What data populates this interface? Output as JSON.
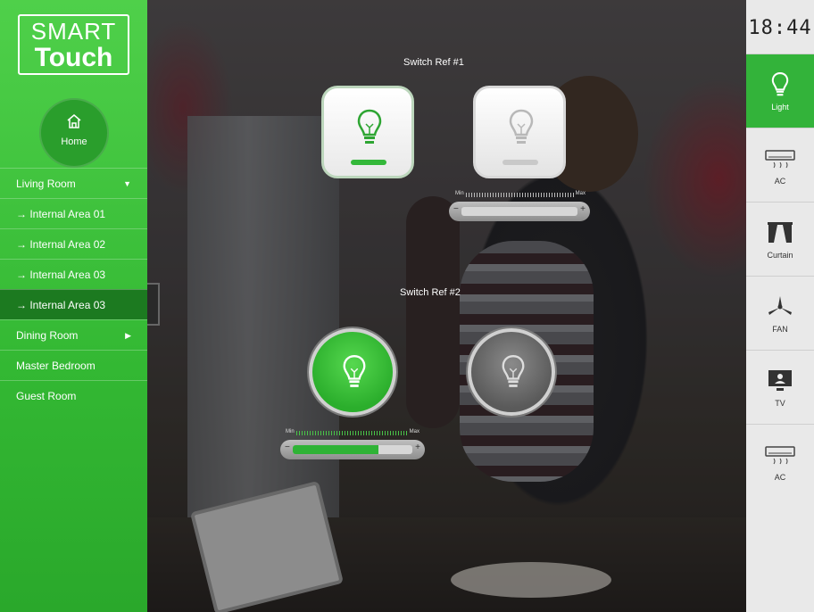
{
  "brand": {
    "line1": "SMART",
    "line2": "Touch"
  },
  "home": {
    "label": "Home"
  },
  "nav": [
    {
      "label": "Living Room",
      "arrow": "▼"
    },
    {
      "label": "→  Internal Area 01"
    },
    {
      "label": "→  Internal Area 02"
    },
    {
      "label": "→  Internal Area 03"
    },
    {
      "label": "→  Internal Area 03"
    },
    {
      "label": "Dining Room",
      "arrow": "▶"
    },
    {
      "label": "Master Bedroom"
    },
    {
      "label": "Guest Room"
    }
  ],
  "clock": "18:44",
  "devices": [
    {
      "label": "Light",
      "icon": "bulb-icon"
    },
    {
      "label": "AC",
      "icon": "ac-icon"
    },
    {
      "label": "Curtain",
      "icon": "curtain-icon"
    },
    {
      "label": "FAN",
      "icon": "fan-icon"
    },
    {
      "label": "TV",
      "icon": "tv-icon"
    },
    {
      "label": "AC",
      "icon": "ac-icon"
    }
  ],
  "switch1": {
    "title": "Switch Ref #1",
    "scale_min": "Min",
    "scale_max": "Max",
    "level": 0
  },
  "switch2": {
    "title": "Switch Ref #2",
    "scale_min": "Min",
    "scale_max": "Max",
    "level": 0.72
  },
  "colors": {
    "accent": "#33b833",
    "active_nav": "#1c7a20",
    "on_indicator": "#34b83a",
    "off_indicator": "#c9c9c9"
  }
}
